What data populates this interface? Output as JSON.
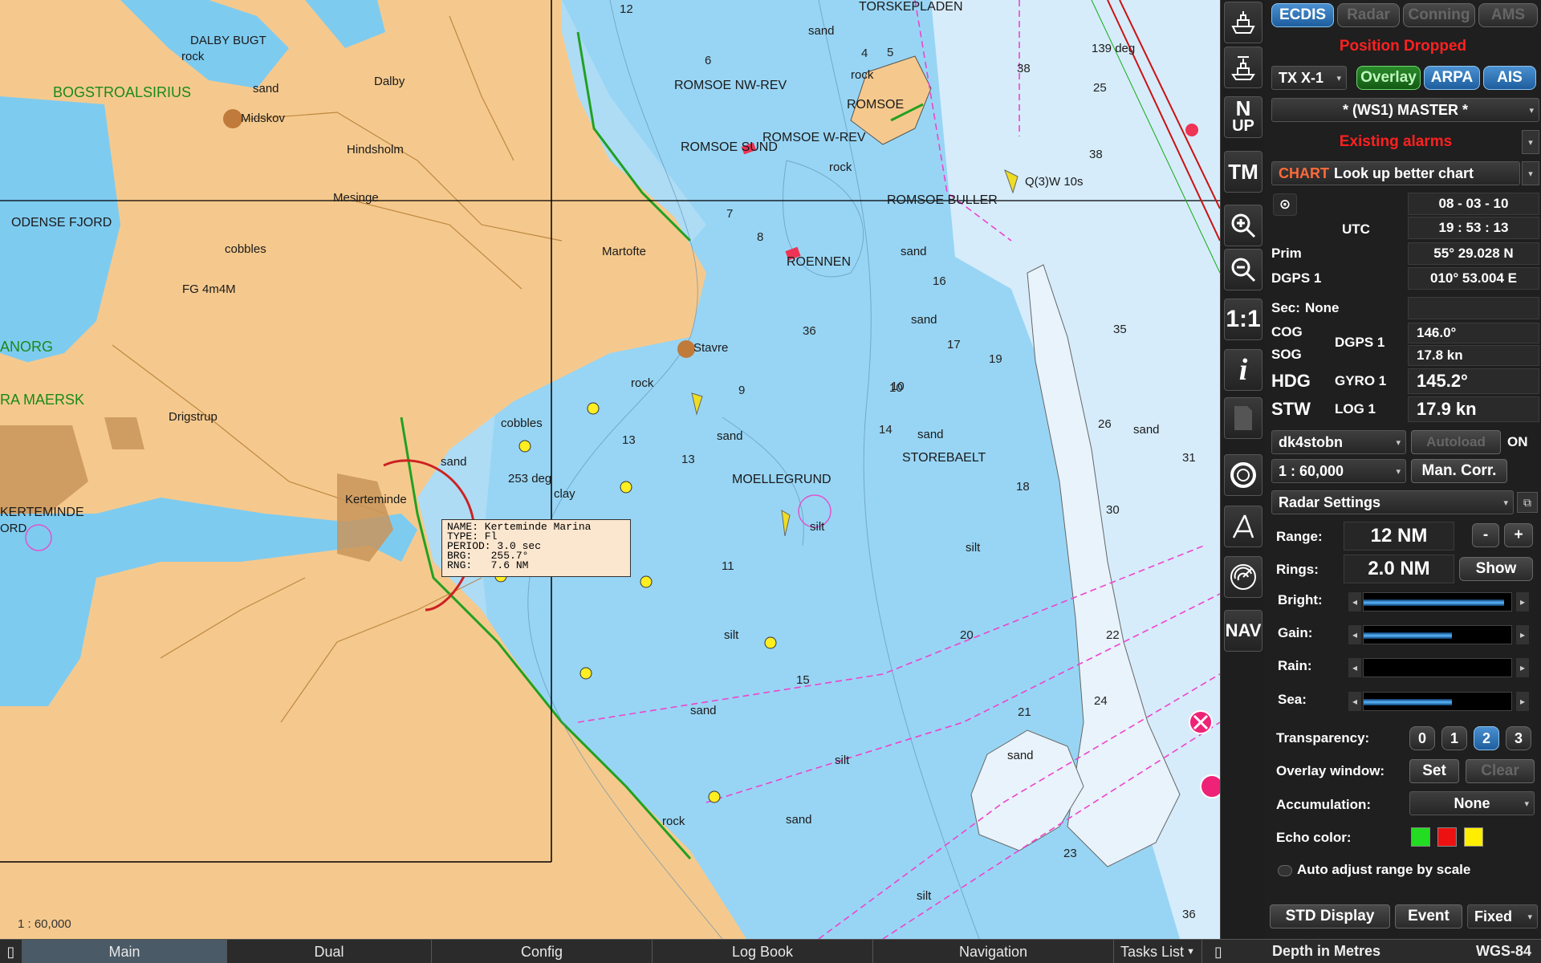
{
  "chart": {
    "scale_label": "1 : 60,000",
    "colors": {
      "land": "#f5c98d",
      "shallow": "#7ecbf0",
      "deep": "#aedcf5",
      "vegetation": "#22a022",
      "route": "#ee44cc"
    },
    "place_labels": [
      {
        "text": "DALBY BUGT",
        "cls": ""
      },
      {
        "text": "Dalby",
        "cls": ""
      },
      {
        "text": "Midskov",
        "cls": ""
      },
      {
        "text": "Hindsholm",
        "cls": ""
      },
      {
        "text": "Mesinge",
        "cls": ""
      },
      {
        "text": "Drigstrup",
        "cls": ""
      },
      {
        "text": "Kerteminde",
        "cls": ""
      },
      {
        "text": "Martofte",
        "cls": ""
      },
      {
        "text": "Stavre",
        "cls": ""
      },
      {
        "text": "ROMSOE",
        "cls": ""
      },
      {
        "text": "ROMSOE NW-REV",
        "cls": ""
      },
      {
        "text": "ROMSOE W-REV",
        "cls": ""
      },
      {
        "text": "ROMSOE SUND",
        "cls": ""
      },
      {
        "text": "ROENNEN",
        "cls": ""
      },
      {
        "text": "STOREBAELT",
        "cls": ""
      },
      {
        "text": "MOELLEGRUND",
        "cls": ""
      },
      {
        "text": "TORSKEPLADEN",
        "cls": ""
      },
      {
        "text": "ROMSOE BULLER",
        "cls": ""
      },
      {
        "text": "KERTEMINDE",
        "cls": ""
      },
      {
        "text": "ODENSE FJORD",
        "cls": ""
      },
      {
        "text": "BOGSTROALSIRIUS",
        "cls": "green"
      },
      {
        "text": "ANORG",
        "cls": "green"
      },
      {
        "text": "RA MAERSK",
        "cls": "green"
      },
      {
        "text": "FG 4m4M",
        "cls": ""
      },
      {
        "text": "Q(3)W 10s",
        "cls": ""
      },
      {
        "text": "139 deg",
        "cls": ""
      },
      {
        "text": "253 deg",
        "cls": ""
      },
      {
        "text": "ORD",
        "cls": ""
      }
    ],
    "seabed_labels": [
      "sand",
      "rock",
      "silt",
      "cobbles",
      "clay"
    ],
    "soundings": [
      "12",
      "6",
      "4",
      "5",
      "7",
      "8",
      "9",
      "10",
      "11",
      "13",
      "14",
      "15",
      "16",
      "17",
      "18",
      "19",
      "20",
      "21",
      "22",
      "23",
      "24",
      "25",
      "26",
      "30",
      "31",
      "35",
      "36",
      "38"
    ]
  },
  "tooltip": {
    "name": "NAME: Kerteminde Marina",
    "type": "TYPE: Fl",
    "period": "PERIOD: 3.0 sec",
    "brg": "BRG:   255.7°",
    "rng": "RNG:   7.6 NM"
  },
  "bottombar": {
    "tabs": [
      "Main",
      "Dual",
      "Config",
      "Log Book",
      "Navigation"
    ],
    "active": "Main",
    "tasks": "Tasks List",
    "depth": "Depth in Metres",
    "datum": "WGS-84"
  },
  "toolbar": {
    "buttons": [
      "own-ship",
      "ship-list",
      "N UP",
      "TM",
      "zoom-in",
      "zoom-out",
      "1:1",
      "i",
      "document",
      "rings",
      "measure",
      "radar",
      "NAV"
    ],
    "north_up_line1": "N",
    "north_up_line2": "UP",
    "tm": "TM",
    "one_to_one": "1:1",
    "info": "i",
    "nav": "NAV"
  },
  "panel": {
    "tabs": {
      "ecdis": "ECDIS",
      "radar": "Radar",
      "conning": "Conning",
      "ams": "AMS"
    },
    "position_status": "Position Dropped",
    "tx": "TX X-1",
    "overlay": "Overlay",
    "arpa": "ARPA",
    "ais": "AIS",
    "master": "* (WS1) MASTER *",
    "existing_alarms": "Existing alarms",
    "chart_prefix": "CHART",
    "chart_msg": "Look up better chart",
    "date": "08 - 03 - 10",
    "utc_label": "UTC",
    "time": "19 : 53 : 13",
    "prim_label": "Prim",
    "lat": "55° 29.028 N",
    "dgps_label": "DGPS 1",
    "lon": "010° 53.004 E",
    "sec_label": "Sec:",
    "sec_value": "None",
    "cog_label": "COG",
    "sog_label": "SOG",
    "cog_src": "DGPS 1",
    "cog": "146.0°",
    "sog": "17.8 kn",
    "hdg_label": "HDG",
    "hdg_src": "GYRO 1",
    "hdg": "145.2°",
    "stw_label": "STW",
    "stw_src": "LOG 1",
    "stw": "17.9 kn",
    "chart_set": "dk4stobn",
    "autoload": "Autoload",
    "autoload_state": "ON",
    "scale": "1 : 60,000",
    "man_corr": "Man. Corr.",
    "radar_settings": "Radar Settings",
    "range_label": "Range:",
    "range": "12 NM",
    "rings_label": "Rings:",
    "rings": "2.0 NM",
    "show": "Show",
    "minus": "-",
    "plus": "+",
    "bright_label": "Bright:",
    "gain_label": "Gain:",
    "rain_label": "Rain:",
    "sea_label": "Sea:",
    "bright_level": 0.95,
    "gain_level": 0.6,
    "rain_level": 0.0,
    "sea_level": 0.6,
    "transparency_label": "Transparency:",
    "transparency_options": [
      "0",
      "1",
      "2",
      "3"
    ],
    "transparency_selected": "2",
    "overlay_window_label": "Overlay window:",
    "set": "Set",
    "clear": "Clear",
    "accumulation_label": "Accumulation:",
    "accumulation": "None",
    "echo_color_label": "Echo color:",
    "echo_colors": [
      "#22dd22",
      "#ee1111",
      "#ffee00"
    ],
    "auto_adjust": "Auto adjust range by scale",
    "std_display": "STD Display",
    "event": "Event",
    "fixed": "Fixed"
  }
}
